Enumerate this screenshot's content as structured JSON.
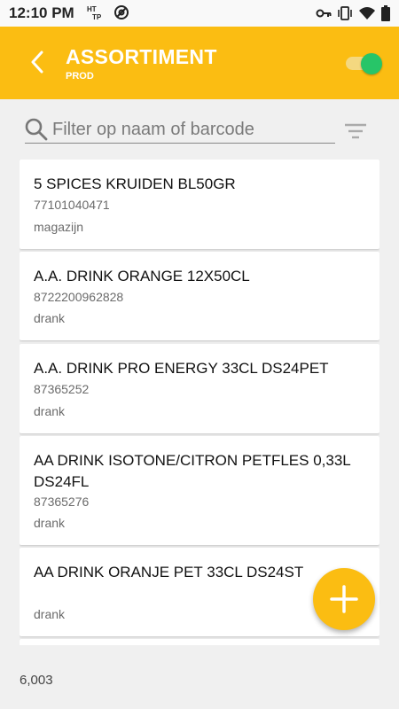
{
  "status_bar": {
    "time": "12:10 PM",
    "icons_left": [
      "http-icon",
      "vpn-at-icon"
    ],
    "icons_right": [
      "key-icon",
      "vibrate-icon",
      "wifi-icon",
      "battery-icon"
    ]
  },
  "header": {
    "title": "ASSORTIMENT",
    "subtitle": "PROD",
    "toggle_on": true,
    "colors": {
      "bar": "#fbbd12",
      "toggle_thumb": "#27c568"
    }
  },
  "search": {
    "placeholder": "Filter op naam of barcode",
    "value": ""
  },
  "products": [
    {
      "name": "5 SPICES KRUIDEN BL50GR",
      "barcode": "77101040471",
      "category": "magazijn"
    },
    {
      "name": "A.A. DRINK ORANGE 12X50CL",
      "barcode": "8722200962828",
      "category": "drank"
    },
    {
      "name": "A.A. DRINK PRO ENERGY 33CL DS24PET",
      "barcode": "87365252",
      "category": "drank"
    },
    {
      "name": "AA DRINK ISOTONE/CITRON PETFLES 0,33L DS24FL",
      "barcode": "87365276",
      "category": "drank"
    },
    {
      "name": "AA DRINK ORANJE PET 33CL DS24ST",
      "barcode": "",
      "category": "drank"
    }
  ],
  "footer": {
    "count": "6,003"
  }
}
